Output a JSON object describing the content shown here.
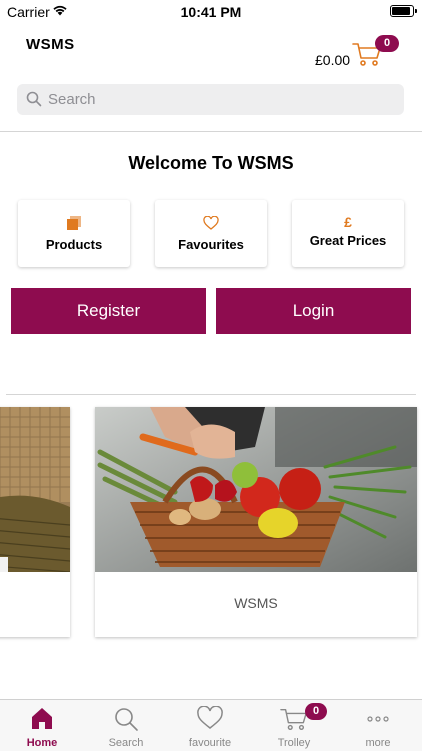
{
  "status_bar": {
    "carrier": "Carrier",
    "time": "10:41 PM"
  },
  "header": {
    "logo": "WSMS",
    "cart_total": "£0.00",
    "cart_count": "0"
  },
  "search": {
    "placeholder": "Search"
  },
  "welcome": "Welcome To WSMS",
  "features": [
    {
      "label": "Products",
      "icon": "stacked-squares-icon"
    },
    {
      "label": "Favourites",
      "icon": "heart-icon"
    },
    {
      "label": "Great Prices",
      "icon": "pound-sign-icon",
      "symbol": "£"
    }
  ],
  "buttons": {
    "register": "Register",
    "login": "Login"
  },
  "carousel": {
    "main_caption": "WSMS"
  },
  "tabbar": {
    "items": [
      {
        "label": "Home",
        "icon": "home-icon"
      },
      {
        "label": "Search",
        "icon": "search-icon"
      },
      {
        "label": "favourite",
        "icon": "heart-icon"
      },
      {
        "label": "Trolley",
        "icon": "cart-icon"
      },
      {
        "label": "more",
        "icon": "more-dots-icon"
      }
    ],
    "trolley_badge": "0"
  },
  "colors": {
    "brand": "#8e0c4f",
    "accent": "#e07a20",
    "active_tab": "#8e0c4f"
  }
}
